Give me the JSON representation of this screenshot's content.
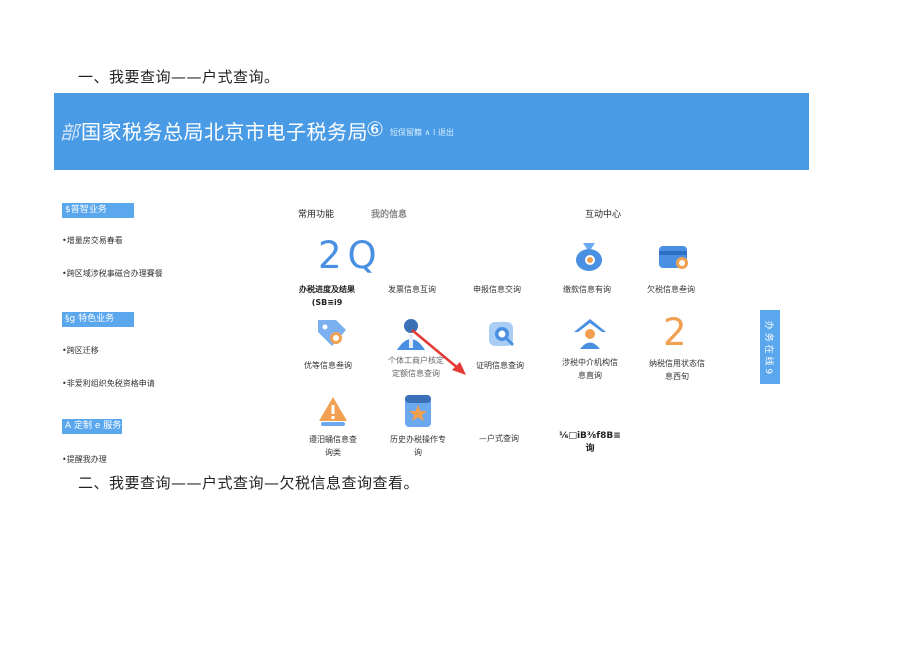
{
  "headings": {
    "one": "一、我要查询——户式查询。",
    "two": "二、我要查询——户式查询—欠税信息查询查看。"
  },
  "banner": {
    "logo_mark": "部",
    "title": "国家税务总局北京市电子税务局",
    "badge": "⑥",
    "meta": "短保留籍 ∧ I 退出",
    "color": "#4a9be6"
  },
  "sidebar": {
    "sections": [
      {
        "tag": "$普智业务",
        "items": [
          "•增量房交易春看",
          "•跨区域涉税事磁合办理賽餐"
        ]
      },
      {
        "tag": "§g 特色业务",
        "items": [
          "•跨区迁移",
          "•非爱利组织免税资格申请"
        ]
      },
      {
        "tag": "A 定制 e 服务",
        "items": [
          "•提醒我办理"
        ]
      }
    ]
  },
  "tabs": {
    "common": "常用功能",
    "mine": "我的信息",
    "interact": "互动中心"
  },
  "glyphs": {
    "twoq": "2Q",
    "two": "2"
  },
  "tiles": [
    {
      "label": "办税进度及结果\n(SB≡i9",
      "icon": "none"
    },
    {
      "label": "发票信息互询",
      "icon": "none"
    },
    {
      "label": "申报信息交询",
      "icon": "none"
    },
    {
      "label": "缴款信息有询",
      "icon": "money-bag-icon"
    },
    {
      "label": "欠税信息叁询",
      "icon": "card-search-icon"
    },
    {
      "label": "优等信息叁询",
      "icon": "tag-search-icon"
    },
    {
      "label": "个体工商户核定\n定额信息查询",
      "icon": "person-icon"
    },
    {
      "label": "证明信息查询",
      "icon": "search-icon"
    },
    {
      "label": "涉税中介机构信\n息直询",
      "icon": "agency-icon"
    },
    {
      "label": "纳税信用状态信\n息西旬",
      "icon": "none"
    },
    {
      "label": "遵汨蛹信息查\n询类",
      "icon": "warning-icon"
    },
    {
      "label": "历史办税操作专\n询",
      "icon": "star-doc-icon"
    },
    {
      "label": "—户式查询",
      "icon": "none"
    },
    {
      "label": "⅙□iB⅜f8B≡\n询",
      "icon": "none"
    }
  ],
  "side_tab": {
    "label": "办 务 在 线 9"
  },
  "colors": {
    "accent": "#4a90e2",
    "highlight": "#5aa7ee",
    "arrow": "#e53935",
    "orange": "#f0a050"
  }
}
